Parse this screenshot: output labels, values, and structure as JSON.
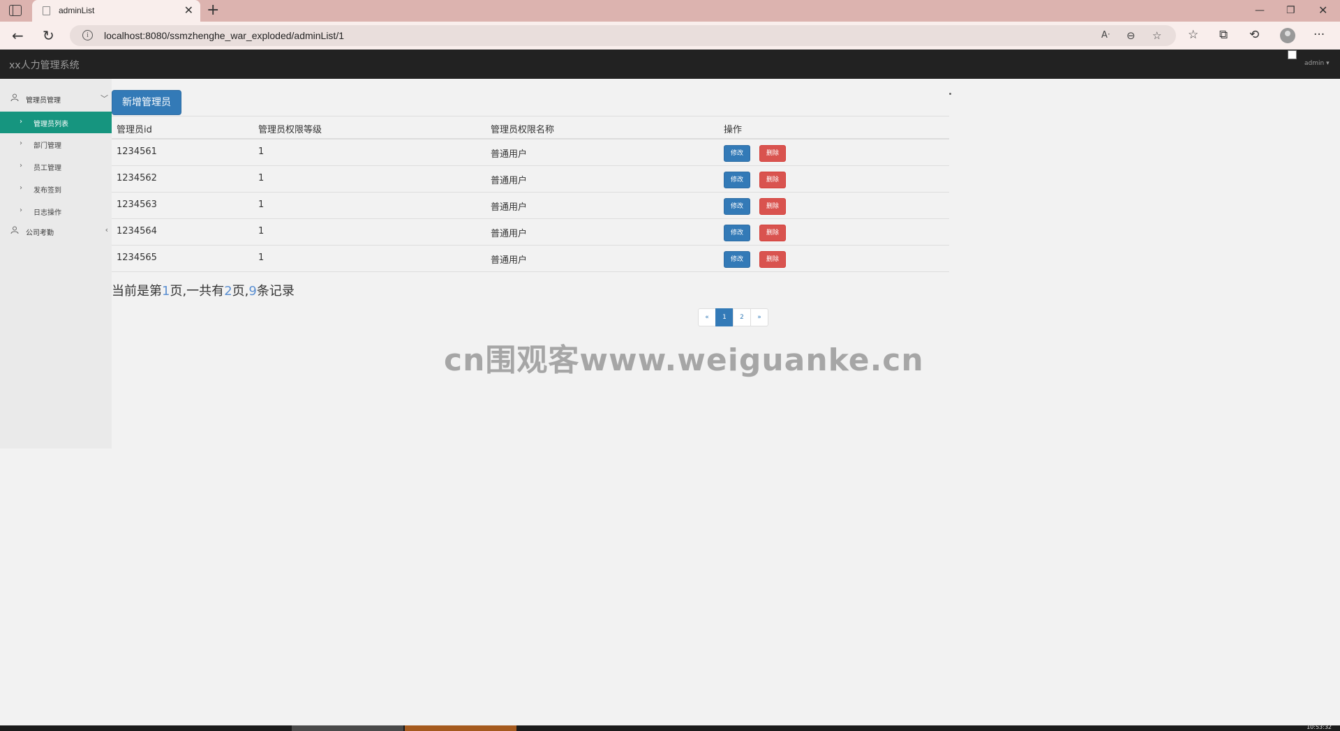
{
  "browser": {
    "tab_title": "adminList",
    "url": "localhost:8080/ssmzhenghe_war_exploded/adminList/1",
    "clock": "10:53:32"
  },
  "app": {
    "brand": "xx人力管理系统",
    "user": "admin"
  },
  "sidebar": {
    "groups": [
      {
        "label": "管理员管理",
        "expanded": true,
        "items": [
          {
            "label": "管理员列表",
            "active": true
          },
          {
            "label": "部门管理",
            "active": false
          },
          {
            "label": "员工管理",
            "active": false
          },
          {
            "label": "发布签到",
            "active": false
          },
          {
            "label": "日志操作",
            "active": false
          }
        ]
      },
      {
        "label": "公司考勤",
        "expanded": false,
        "items": []
      }
    ]
  },
  "main": {
    "add_button": "新增管理员",
    "table": {
      "headers": [
        "管理员id",
        "管理员权限等级",
        "管理员权限名称",
        "操作"
      ],
      "rows": [
        {
          "id": "1234561",
          "level": "1",
          "name": "普通用户"
        },
        {
          "id": "1234562",
          "level": "1",
          "name": "普通用户"
        },
        {
          "id": "1234563",
          "level": "1",
          "name": "普通用户"
        },
        {
          "id": "1234564",
          "level": "1",
          "name": "普通用户"
        },
        {
          "id": "1234565",
          "level": "1",
          "name": "普通用户"
        }
      ],
      "edit_label": "修改",
      "delete_label": "删除"
    },
    "page_info": {
      "prefix": "当前是第",
      "current": "1",
      "mid1": "页,一共有",
      "total_pages": "2",
      "mid2": "页,",
      "records": "9",
      "suffix": "条记录"
    },
    "pagination": [
      "«",
      "1",
      "2",
      "»"
    ],
    "active_page": "1"
  },
  "watermark": "cn围观客www.weiguanke.cn",
  "colors": {
    "primary": "#337ab7",
    "danger": "#d9534f",
    "sidebar_active": "#16957f",
    "navbar": "#222222",
    "tabbar": "#dcb3af"
  }
}
